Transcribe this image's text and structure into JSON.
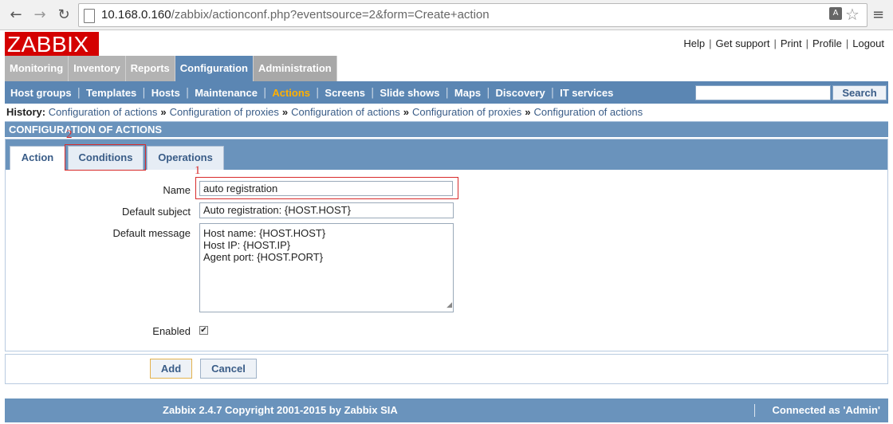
{
  "browser": {
    "back_glyph": "←",
    "forward_glyph": "→",
    "reload_glyph": "↻",
    "url_host": "10.168.0.160",
    "url_path": "/zabbix/actionconf.php?eventsource=2&form=Create+action",
    "menu_glyph": "≡",
    "star_glyph": "☆",
    "translate_glyph": "A"
  },
  "header": {
    "logo": "ZABBIX",
    "links": [
      "Help",
      "Get support",
      "Print",
      "Profile",
      "Logout"
    ],
    "separator": "|"
  },
  "main_menu": [
    "Monitoring",
    "Inventory",
    "Reports",
    "Configuration",
    "Administration"
  ],
  "main_menu_active": "Configuration",
  "sub_menu": [
    "Host groups",
    "Templates",
    "Hosts",
    "Maintenance",
    "Actions",
    "Screens",
    "Slide shows",
    "Maps",
    "Discovery",
    "IT services"
  ],
  "sub_menu_active": "Actions",
  "sub_menu_separator": "|",
  "search": {
    "value": "",
    "button": "Search"
  },
  "history": {
    "label": "History:",
    "items": [
      "Configuration of actions",
      "Configuration of proxies",
      "Configuration of actions",
      "Configuration of proxies",
      "Configuration of actions"
    ],
    "separator": "»"
  },
  "section_title": "CONFIGURATION OF ACTIONS",
  "tabs": [
    "Action",
    "Conditions",
    "Operations"
  ],
  "active_tab": "Action",
  "annotations": {
    "name_marker": "1",
    "conditions_marker": "2"
  },
  "form": {
    "name_label": "Name",
    "name_value": "auto registration",
    "subject_label": "Default subject",
    "subject_value": "Auto registration: {HOST.HOST}",
    "message_label": "Default message",
    "message_value": "Host name: {HOST.HOST}\nHost IP: {HOST.IP}\nAgent port: {HOST.PORT}",
    "enabled_label": "Enabled",
    "enabled_checked": true,
    "check_glyph": "✔"
  },
  "buttons": {
    "add": "Add",
    "cancel": "Cancel"
  },
  "footer": {
    "copyright": "Zabbix 2.4.7 Copyright 2001-2015 by Zabbix SIA",
    "connected": "Connected as 'Admin'"
  },
  "colors": {
    "brand_red": "#d40000",
    "menu_blue": "#5b86b3",
    "active_submenu": "#ffb000",
    "annotation_red": "#d82a2a"
  }
}
